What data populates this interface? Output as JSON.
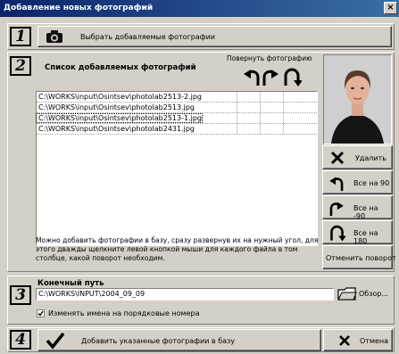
{
  "window": {
    "title": "Добавление новых фотографий",
    "close_glyph": "×"
  },
  "steps": [
    "1",
    "2",
    "3",
    "4"
  ],
  "step1": {
    "select_label": "Выбрать добавляемые фотографии",
    "icon": "camera-icon"
  },
  "step2": {
    "list_title": "Список добавляемых фотографий",
    "rotate_header": "Повернуть фотографию",
    "files": [
      "C:\\WORKS\\input\\Osintsev\\photolab2513-2.jpg",
      "C:\\WORKS\\input\\Osintsev\\photolab2513.jpg",
      "C:\\WORKS\\input\\Osintsev\\photolab2513-1.jpg",
      "C:\\WORKS\\input\\Osintsev\\photolab2431.jpg"
    ],
    "hint": "Можно добавить фотографии в базу, сразу развернув их на нужный угол, для этого дважды щелкните левой кнопкой мыши для каждого файла в том столбце, какой поворот необходим.",
    "buttons": {
      "delete": "Удалить",
      "all90": "Все на 90",
      "allm90": "Все на -90",
      "all180": "Все на 180",
      "cancel_rotate": "Отменить поворот"
    }
  },
  "step3": {
    "path_label": "Конечный путь",
    "path_value": "C:\\WORKS\\INPUT\\2004_09_09",
    "browse_label": "Обзор...",
    "rename_label": "Изменять имена на порядковые номера",
    "rename_checked": true
  },
  "step4": {
    "add_label": "Добавить указанные фотографии в базу",
    "cancel_label": "Отмена"
  },
  "colors": {
    "titlebar_start": "#0a246a",
    "titlebar_end": "#3a6ea5",
    "face": "#d4d0c8"
  }
}
